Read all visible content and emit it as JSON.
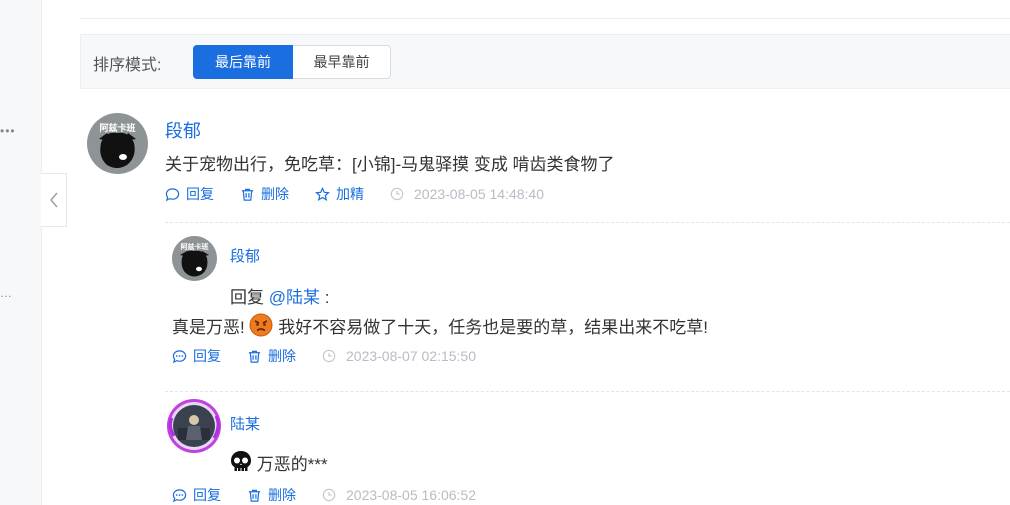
{
  "rail": {
    "dots_top": "•••",
    "dots_bottom": "…"
  },
  "sort": {
    "label": "排序模式:",
    "options": [
      "最后靠前",
      "最早靠前"
    ],
    "active": "最后靠前"
  },
  "comment": {
    "author": "段郁",
    "avatar_text": "阿兹卡班",
    "body": "关于宠物出行，免吃草：[小锦]-马鬼驿摸 变成 啃齿类食物了",
    "actions": {
      "reply": "回复",
      "delete": "删除",
      "feature": "加精"
    },
    "time": "2023-08-05 14:48:40"
  },
  "replies": [
    {
      "author": "段郁",
      "avatar_text": "阿兹卡班",
      "reply_prefix": "回复",
      "mention": "@陆某",
      "colon": ":",
      "body_a": "真是万恶!",
      "body_b": "我好不容易做了十天，任务也是要的草，结果出来不吃草!",
      "emoji": "angry-face-emoji",
      "actions": {
        "reply": "回复",
        "delete": "删除"
      },
      "time": "2023-08-07 02:15:50"
    },
    {
      "author": "陆某",
      "body": "万恶的***",
      "emoji": "skull-emoji",
      "actions": {
        "reply": "回复",
        "delete": "删除"
      },
      "time": "2023-08-05 16:06:52"
    }
  ],
  "colors": {
    "accent": "#1a6ee0",
    "muted": "#b8bcc4",
    "text": "#333333"
  }
}
